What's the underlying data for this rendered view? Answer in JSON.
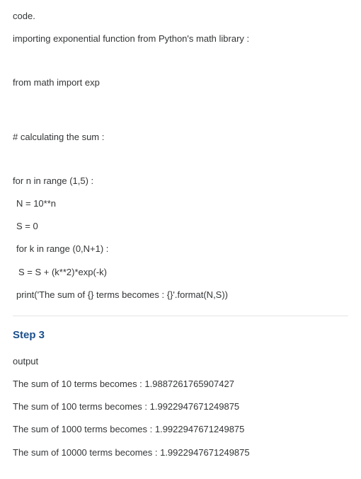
{
  "intro": {
    "code_word": "code.",
    "desc": "importing exponential function from Python's math library :"
  },
  "code": {
    "import_line": "from math import exp",
    "comment_line": "# calculating the sum :",
    "for_outer": "for n in range (1,5) :",
    "assign_N": "N = 10**n",
    "assign_S": "S = 0",
    "for_inner": "for k in range (0,N+1) :",
    "update_S": "S = S + (k**2)*exp(-k)",
    "print_line": "print('The sum of {} terms becomes : {}'.format(N,S))"
  },
  "step": {
    "heading": "Step 3",
    "output_label": "output"
  },
  "output": [
    "The sum of 10 terms becomes : 1.9887261765907427",
    "The sum of 100 terms becomes : 1.9922947671249875",
    "The sum of 1000 terms becomes : 1.9922947671249875",
    "The sum of 10000 terms becomes : 1.9922947671249875"
  ]
}
